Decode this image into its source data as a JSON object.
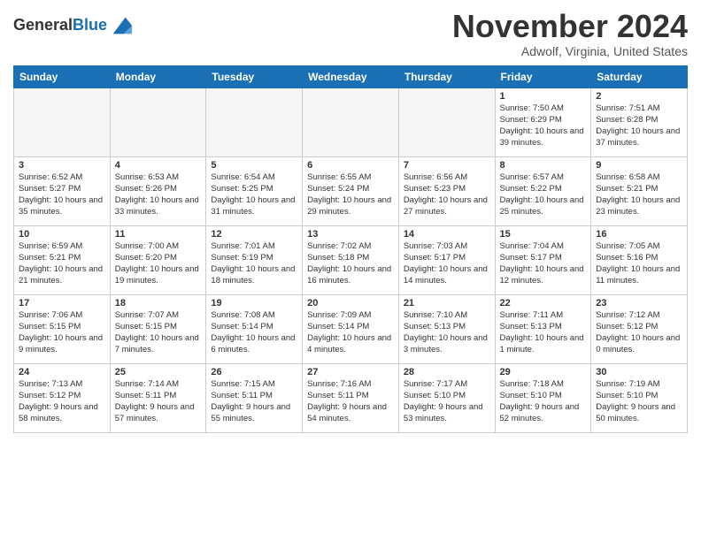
{
  "header": {
    "logo_line1": "General",
    "logo_line2": "Blue",
    "month_title": "November 2024",
    "location": "Adwolf, Virginia, United States"
  },
  "weekdays": [
    "Sunday",
    "Monday",
    "Tuesday",
    "Wednesday",
    "Thursday",
    "Friday",
    "Saturday"
  ],
  "weeks": [
    [
      {
        "day": "",
        "sunrise": "",
        "sunset": "",
        "daylight": "",
        "empty": true
      },
      {
        "day": "",
        "sunrise": "",
        "sunset": "",
        "daylight": "",
        "empty": true
      },
      {
        "day": "",
        "sunrise": "",
        "sunset": "",
        "daylight": "",
        "empty": true
      },
      {
        "day": "",
        "sunrise": "",
        "sunset": "",
        "daylight": "",
        "empty": true
      },
      {
        "day": "",
        "sunrise": "",
        "sunset": "",
        "daylight": "",
        "empty": true
      },
      {
        "day": "1",
        "sunrise": "Sunrise: 7:50 AM",
        "sunset": "Sunset: 6:29 PM",
        "daylight": "Daylight: 10 hours and 39 minutes.",
        "empty": false
      },
      {
        "day": "2",
        "sunrise": "Sunrise: 7:51 AM",
        "sunset": "Sunset: 6:28 PM",
        "daylight": "Daylight: 10 hours and 37 minutes.",
        "empty": false
      }
    ],
    [
      {
        "day": "3",
        "sunrise": "Sunrise: 6:52 AM",
        "sunset": "Sunset: 5:27 PM",
        "daylight": "Daylight: 10 hours and 35 minutes.",
        "empty": false
      },
      {
        "day": "4",
        "sunrise": "Sunrise: 6:53 AM",
        "sunset": "Sunset: 5:26 PM",
        "daylight": "Daylight: 10 hours and 33 minutes.",
        "empty": false
      },
      {
        "day": "5",
        "sunrise": "Sunrise: 6:54 AM",
        "sunset": "Sunset: 5:25 PM",
        "daylight": "Daylight: 10 hours and 31 minutes.",
        "empty": false
      },
      {
        "day": "6",
        "sunrise": "Sunrise: 6:55 AM",
        "sunset": "Sunset: 5:24 PM",
        "daylight": "Daylight: 10 hours and 29 minutes.",
        "empty": false
      },
      {
        "day": "7",
        "sunrise": "Sunrise: 6:56 AM",
        "sunset": "Sunset: 5:23 PM",
        "daylight": "Daylight: 10 hours and 27 minutes.",
        "empty": false
      },
      {
        "day": "8",
        "sunrise": "Sunrise: 6:57 AM",
        "sunset": "Sunset: 5:22 PM",
        "daylight": "Daylight: 10 hours and 25 minutes.",
        "empty": false
      },
      {
        "day": "9",
        "sunrise": "Sunrise: 6:58 AM",
        "sunset": "Sunset: 5:21 PM",
        "daylight": "Daylight: 10 hours and 23 minutes.",
        "empty": false
      }
    ],
    [
      {
        "day": "10",
        "sunrise": "Sunrise: 6:59 AM",
        "sunset": "Sunset: 5:21 PM",
        "daylight": "Daylight: 10 hours and 21 minutes.",
        "empty": false
      },
      {
        "day": "11",
        "sunrise": "Sunrise: 7:00 AM",
        "sunset": "Sunset: 5:20 PM",
        "daylight": "Daylight: 10 hours and 19 minutes.",
        "empty": false
      },
      {
        "day": "12",
        "sunrise": "Sunrise: 7:01 AM",
        "sunset": "Sunset: 5:19 PM",
        "daylight": "Daylight: 10 hours and 18 minutes.",
        "empty": false
      },
      {
        "day": "13",
        "sunrise": "Sunrise: 7:02 AM",
        "sunset": "Sunset: 5:18 PM",
        "daylight": "Daylight: 10 hours and 16 minutes.",
        "empty": false
      },
      {
        "day": "14",
        "sunrise": "Sunrise: 7:03 AM",
        "sunset": "Sunset: 5:17 PM",
        "daylight": "Daylight: 10 hours and 14 minutes.",
        "empty": false
      },
      {
        "day": "15",
        "sunrise": "Sunrise: 7:04 AM",
        "sunset": "Sunset: 5:17 PM",
        "daylight": "Daylight: 10 hours and 12 minutes.",
        "empty": false
      },
      {
        "day": "16",
        "sunrise": "Sunrise: 7:05 AM",
        "sunset": "Sunset: 5:16 PM",
        "daylight": "Daylight: 10 hours and 11 minutes.",
        "empty": false
      }
    ],
    [
      {
        "day": "17",
        "sunrise": "Sunrise: 7:06 AM",
        "sunset": "Sunset: 5:15 PM",
        "daylight": "Daylight: 10 hours and 9 minutes.",
        "empty": false
      },
      {
        "day": "18",
        "sunrise": "Sunrise: 7:07 AM",
        "sunset": "Sunset: 5:15 PM",
        "daylight": "Daylight: 10 hours and 7 minutes.",
        "empty": false
      },
      {
        "day": "19",
        "sunrise": "Sunrise: 7:08 AM",
        "sunset": "Sunset: 5:14 PM",
        "daylight": "Daylight: 10 hours and 6 minutes.",
        "empty": false
      },
      {
        "day": "20",
        "sunrise": "Sunrise: 7:09 AM",
        "sunset": "Sunset: 5:14 PM",
        "daylight": "Daylight: 10 hours and 4 minutes.",
        "empty": false
      },
      {
        "day": "21",
        "sunrise": "Sunrise: 7:10 AM",
        "sunset": "Sunset: 5:13 PM",
        "daylight": "Daylight: 10 hours and 3 minutes.",
        "empty": false
      },
      {
        "day": "22",
        "sunrise": "Sunrise: 7:11 AM",
        "sunset": "Sunset: 5:13 PM",
        "daylight": "Daylight: 10 hours and 1 minute.",
        "empty": false
      },
      {
        "day": "23",
        "sunrise": "Sunrise: 7:12 AM",
        "sunset": "Sunset: 5:12 PM",
        "daylight": "Daylight: 10 hours and 0 minutes.",
        "empty": false
      }
    ],
    [
      {
        "day": "24",
        "sunrise": "Sunrise: 7:13 AM",
        "sunset": "Sunset: 5:12 PM",
        "daylight": "Daylight: 9 hours and 58 minutes.",
        "empty": false
      },
      {
        "day": "25",
        "sunrise": "Sunrise: 7:14 AM",
        "sunset": "Sunset: 5:11 PM",
        "daylight": "Daylight: 9 hours and 57 minutes.",
        "empty": false
      },
      {
        "day": "26",
        "sunrise": "Sunrise: 7:15 AM",
        "sunset": "Sunset: 5:11 PM",
        "daylight": "Daylight: 9 hours and 55 minutes.",
        "empty": false
      },
      {
        "day": "27",
        "sunrise": "Sunrise: 7:16 AM",
        "sunset": "Sunset: 5:11 PM",
        "daylight": "Daylight: 9 hours and 54 minutes.",
        "empty": false
      },
      {
        "day": "28",
        "sunrise": "Sunrise: 7:17 AM",
        "sunset": "Sunset: 5:10 PM",
        "daylight": "Daylight: 9 hours and 53 minutes.",
        "empty": false
      },
      {
        "day": "29",
        "sunrise": "Sunrise: 7:18 AM",
        "sunset": "Sunset: 5:10 PM",
        "daylight": "Daylight: 9 hours and 52 minutes.",
        "empty": false
      },
      {
        "day": "30",
        "sunrise": "Sunrise: 7:19 AM",
        "sunset": "Sunset: 5:10 PM",
        "daylight": "Daylight: 9 hours and 50 minutes.",
        "empty": false
      }
    ]
  ]
}
